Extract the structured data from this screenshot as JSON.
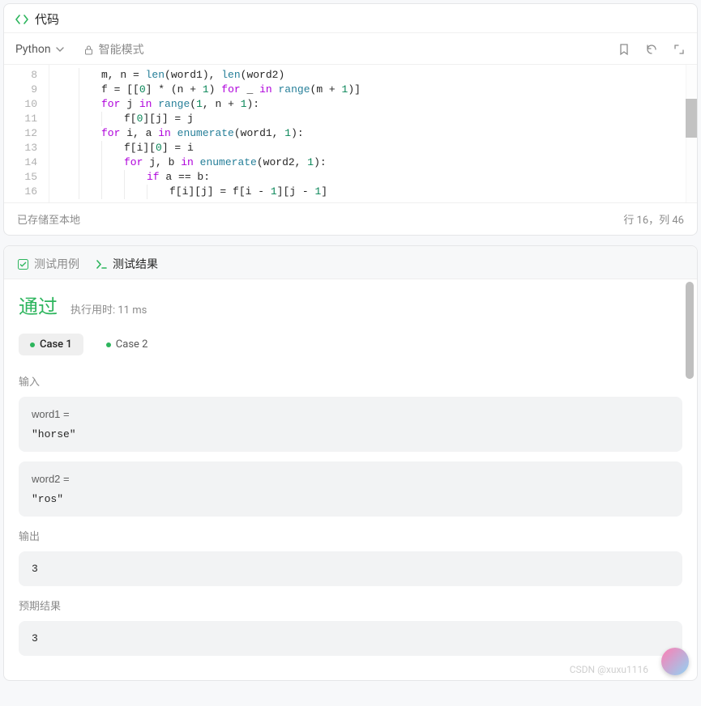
{
  "codePanel": {
    "title": "代码",
    "language": "Python",
    "mode": "智能模式",
    "statusLeft": "已存储至本地",
    "statusRight": "行 16，列 46"
  },
  "editor": {
    "startLine": 8,
    "lines": [
      [
        {
          "t": "m, n = ",
          "c": ""
        },
        {
          "t": "len",
          "c": "tok-fn"
        },
        {
          "t": "(word1), ",
          "c": ""
        },
        {
          "t": "len",
          "c": "tok-fn"
        },
        {
          "t": "(word2)",
          "c": ""
        }
      ],
      [
        {
          "t": "f = [[",
          "c": ""
        },
        {
          "t": "0",
          "c": "tok-num"
        },
        {
          "t": "] * (n + ",
          "c": ""
        },
        {
          "t": "1",
          "c": "tok-num"
        },
        {
          "t": ") ",
          "c": ""
        },
        {
          "t": "for",
          "c": "tok-kw"
        },
        {
          "t": " _ ",
          "c": ""
        },
        {
          "t": "in",
          "c": "tok-kw"
        },
        {
          "t": " ",
          "c": ""
        },
        {
          "t": "range",
          "c": "tok-fn"
        },
        {
          "t": "(m + ",
          "c": ""
        },
        {
          "t": "1",
          "c": "tok-num"
        },
        {
          "t": ")]",
          "c": ""
        }
      ],
      [
        {
          "t": "for",
          "c": "tok-kw"
        },
        {
          "t": " j ",
          "c": ""
        },
        {
          "t": "in",
          "c": "tok-kw"
        },
        {
          "t": " ",
          "c": ""
        },
        {
          "t": "range",
          "c": "tok-fn"
        },
        {
          "t": "(",
          "c": ""
        },
        {
          "t": "1",
          "c": "tok-num"
        },
        {
          "t": ", n + ",
          "c": ""
        },
        {
          "t": "1",
          "c": "tok-num"
        },
        {
          "t": "):",
          "c": ""
        }
      ],
      [
        {
          "t": "f[",
          "c": ""
        },
        {
          "t": "0",
          "c": "tok-num"
        },
        {
          "t": "][j] = j",
          "c": ""
        }
      ],
      [
        {
          "t": "for",
          "c": "tok-kw"
        },
        {
          "t": " i, a ",
          "c": ""
        },
        {
          "t": "in",
          "c": "tok-kw"
        },
        {
          "t": " ",
          "c": ""
        },
        {
          "t": "enumerate",
          "c": "tok-fn"
        },
        {
          "t": "(word1, ",
          "c": ""
        },
        {
          "t": "1",
          "c": "tok-num"
        },
        {
          "t": "):",
          "c": ""
        }
      ],
      [
        {
          "t": "f[i][",
          "c": ""
        },
        {
          "t": "0",
          "c": "tok-num"
        },
        {
          "t": "] = i",
          "c": ""
        }
      ],
      [
        {
          "t": "for",
          "c": "tok-kw"
        },
        {
          "t": " j, b ",
          "c": ""
        },
        {
          "t": "in",
          "c": "tok-kw"
        },
        {
          "t": " ",
          "c": ""
        },
        {
          "t": "enumerate",
          "c": "tok-fn"
        },
        {
          "t": "(word2, ",
          "c": ""
        },
        {
          "t": "1",
          "c": "tok-num"
        },
        {
          "t": "):",
          "c": ""
        }
      ],
      [
        {
          "t": "if",
          "c": "tok-kw"
        },
        {
          "t": " a == b:",
          "c": ""
        }
      ],
      [
        {
          "t": "f[i][j] = f[i - ",
          "c": ""
        },
        {
          "t": "1",
          "c": "tok-num"
        },
        {
          "t": "][j - ",
          "c": ""
        },
        {
          "t": "1",
          "c": "tok-num"
        },
        {
          "t": "]",
          "c": ""
        }
      ]
    ],
    "indents": [
      2,
      2,
      2,
      3,
      2,
      3,
      3,
      4,
      5
    ]
  },
  "results": {
    "tabCases": "测试用例",
    "tabResults": "测试结果",
    "passText": "通过",
    "runtime": "执行用时: 11 ms",
    "caseTabs": [
      "Case 1",
      "Case 2"
    ],
    "inputLabel": "输入",
    "outputLabel": "输出",
    "expectedLabel": "预期结果",
    "inputs": [
      {
        "label": "word1 =",
        "value": "\"horse\""
      },
      {
        "label": "word2 =",
        "value": "\"ros\""
      }
    ],
    "output": "3",
    "expected": "3"
  },
  "watermark": "CSDN @xuxu1116"
}
